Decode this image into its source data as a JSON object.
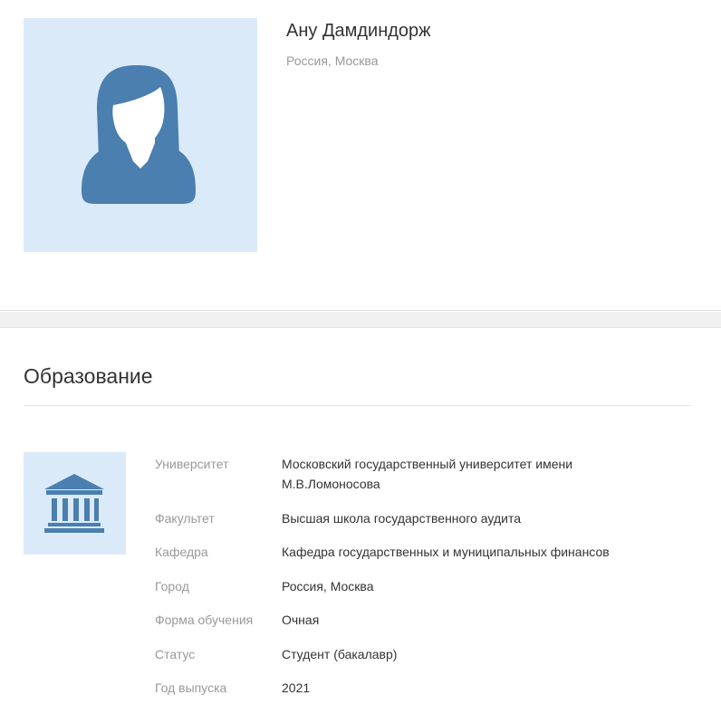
{
  "profile": {
    "name": "Ану Дамдиндорж",
    "location": "Россия, Москва"
  },
  "education": {
    "title": "Образование",
    "rows": [
      {
        "label": "Университет",
        "value": "Московский государственный университет имени М.В.Ломоносова"
      },
      {
        "label": "Факультет",
        "value": "Высшая школа государственного аудита"
      },
      {
        "label": "Кафедра",
        "value": "Кафедра государственных и муниципальных финансов"
      },
      {
        "label": "Город",
        "value": "Россия, Москва"
      },
      {
        "label": "Форма обучения",
        "value": "Очная"
      },
      {
        "label": "Статус",
        "value": "Студент (бакалавр)"
      },
      {
        "label": "Год выпуска",
        "value": "2021"
      }
    ]
  },
  "colors": {
    "icon_blue": "#4a7faf",
    "icon_bg": "#dbeaf8",
    "label_gray": "#999999",
    "text_dark": "#333333"
  },
  "icons": {
    "avatar": "female-user-silhouette-icon",
    "university": "university-building-icon"
  }
}
